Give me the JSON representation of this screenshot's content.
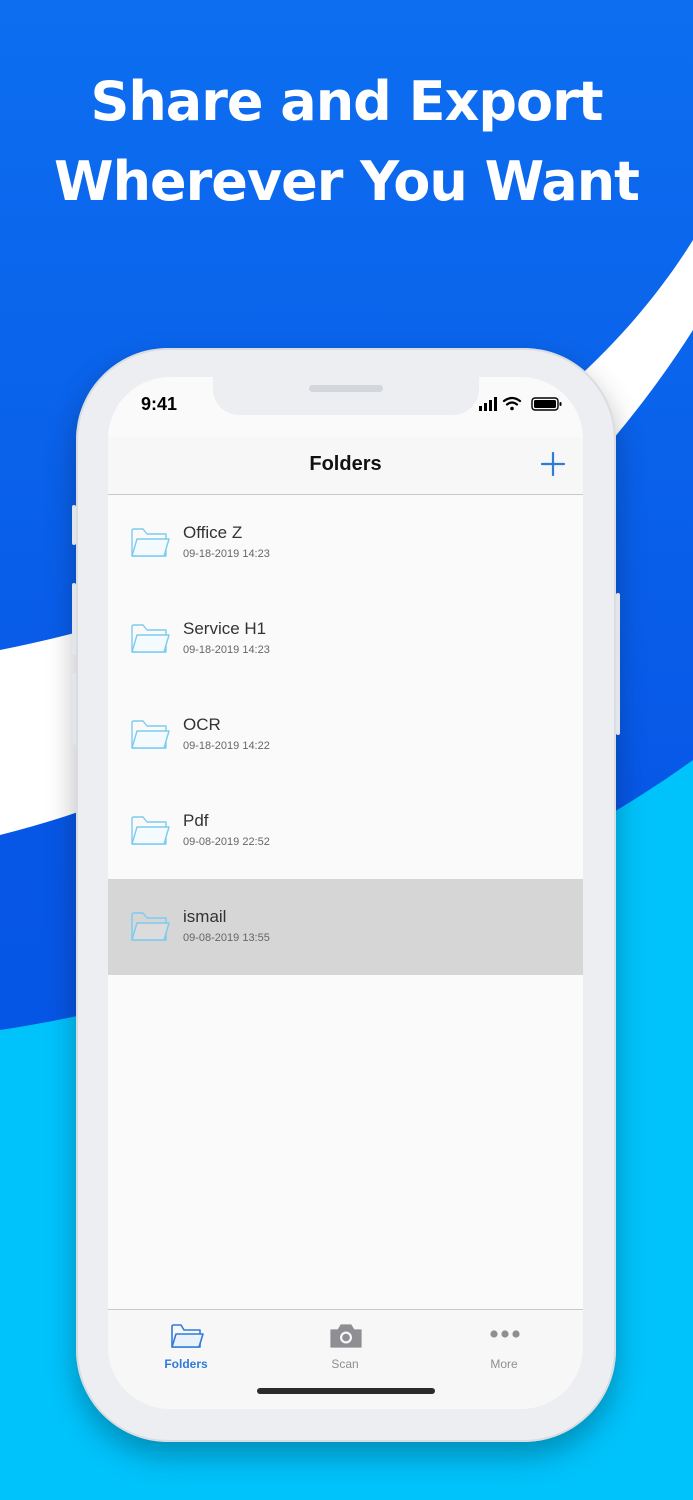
{
  "headline": {
    "line1": "Share and Export",
    "line2": "Wherever You Want"
  },
  "colors": {
    "background_top": "#0a66ea",
    "background_bottom": "#00c2fb",
    "swoosh": "#ffffff",
    "accent": "#2f7bd8",
    "folder_icon": "#7ccbf0"
  },
  "status_bar": {
    "time": "9:41",
    "icons": [
      "signal-icon",
      "wifi-icon",
      "battery-icon"
    ]
  },
  "navbar": {
    "title": "Folders",
    "add_icon": "plus-icon"
  },
  "folders": [
    {
      "name": "Office Z",
      "date": "09-18-2019 14:23",
      "selected": false
    },
    {
      "name": "Service H1",
      "date": "09-18-2019 14:23",
      "selected": false
    },
    {
      "name": "OCR",
      "date": "09-18-2019 14:22",
      "selected": false
    },
    {
      "name": "Pdf",
      "date": "09-08-2019 22:52",
      "selected": false
    },
    {
      "name": "ismail",
      "date": "09-08-2019 13:55",
      "selected": true
    }
  ],
  "tabbar": {
    "tabs": [
      {
        "label": "Folders",
        "icon": "folder-icon",
        "active": true
      },
      {
        "label": "Scan",
        "icon": "camera-icon",
        "active": false
      },
      {
        "label": "More",
        "icon": "more-icon",
        "active": false
      }
    ]
  }
}
